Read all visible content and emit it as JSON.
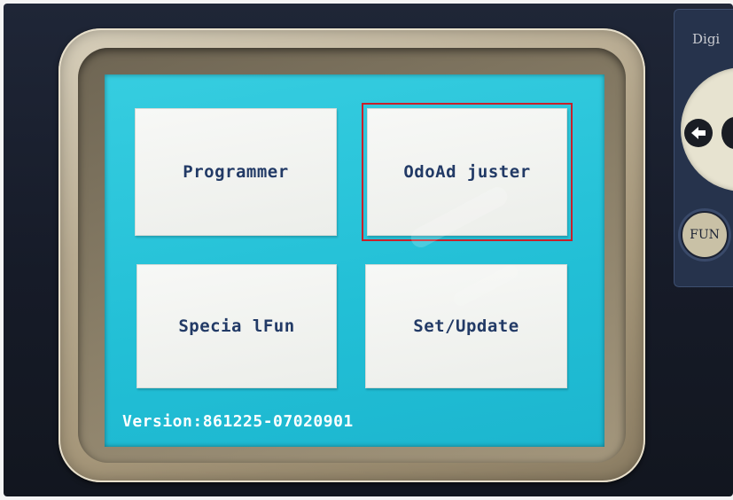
{
  "screen": {
    "tiles": [
      {
        "label": "Programmer"
      },
      {
        "label": "OdoAd juster"
      },
      {
        "label": "Specia lFun"
      },
      {
        "label": "Set/Update"
      }
    ],
    "version_text": "Version:861225-07020901",
    "selected_tile": "OdoAd juster"
  },
  "side_panel": {
    "title": "Digi",
    "fun_label": "FUN"
  },
  "colors": {
    "screen_bg": "#22bfd6",
    "tile_bg": "#f2f3f1",
    "tile_text": "#223a66",
    "selection_outline": "#c8202a",
    "version_text": "#ffffff"
  },
  "icons": [
    "left-arrow-icon"
  ]
}
